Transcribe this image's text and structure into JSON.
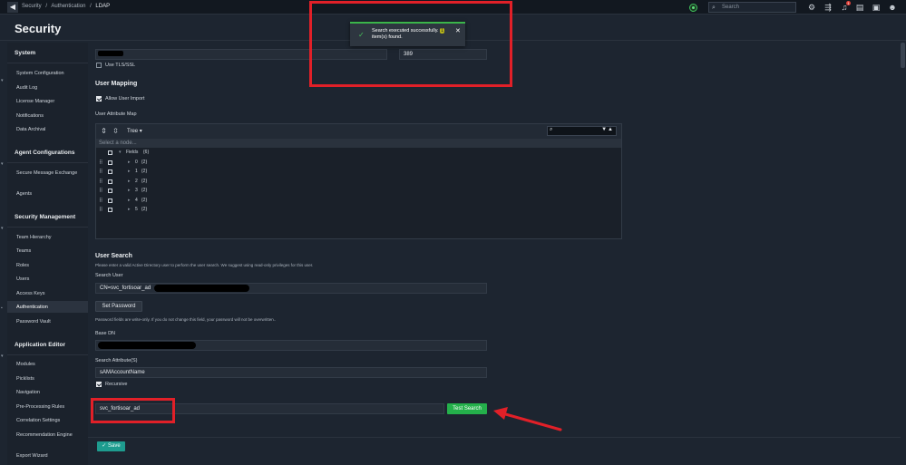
{
  "topbar": {
    "back_icon": "arrow-left-icon",
    "breadcrumb": [
      "Security",
      "/",
      "Authentication",
      "/"
    ],
    "breadcrumb_current": "LDAP",
    "search_placeholder": "Search",
    "notification_count": "1",
    "icons": [
      "status-icon",
      "search-icon",
      "gear-icon",
      "share-icon",
      "bell-icon",
      "clipboard-icon",
      "monitor-icon",
      "user-icon"
    ]
  },
  "page": {
    "title": "Security"
  },
  "sidebar": {
    "sections": [
      {
        "title": "System",
        "items": [
          "System Configuration",
          "Audit Log",
          "License Manager",
          "Notifications",
          "Data Archival"
        ]
      },
      {
        "title": "Agent Configurations",
        "items": [
          "Secure Message Exchange",
          "Agents"
        ]
      },
      {
        "title": "Security Management",
        "items": [
          "Team Hierarchy",
          "Teams",
          "Roles",
          "Users",
          "Access Keys",
          "Authentication",
          "Password Vault"
        ]
      },
      {
        "title": "Application Editor",
        "items": [
          "Modules",
          "Picklists",
          "Navigation",
          "Pre-Processing Rules",
          "Correlation Settings",
          "Recommendation Engine",
          "Export Wizard"
        ]
      }
    ],
    "active_item": "Authentication"
  },
  "form": {
    "port_value": "389",
    "use_tls_label": "Use TLS/SSL",
    "user_mapping_title": "User Mapping",
    "allow_user_import_label": "Allow User Import",
    "user_attribute_map_label": "User Attribute Map",
    "tree": {
      "view_label": "Tree ▾",
      "select_placeholder": "Select a node...",
      "root_label": "Fields",
      "root_count": "{6}",
      "children": [
        {
          "key": "0",
          "count": "{2}"
        },
        {
          "key": "1",
          "count": "{2}"
        },
        {
          "key": "2",
          "count": "{2}"
        },
        {
          "key": "3",
          "count": "{2}"
        },
        {
          "key": "4",
          "count": "{2}"
        },
        {
          "key": "5",
          "count": "{2}"
        }
      ]
    },
    "user_search_title": "User Search",
    "user_search_hint": "Please enter a valid Active Directory user to perform the user search. We suggest using read-only privileges for this user.",
    "search_user_label": "Search User",
    "search_user_value": "CN=svc_fortisoar_ad",
    "set_password_label": "Set Password",
    "password_hint": "Password fields are write-only. If you do not change this field, your password will not be overwritten..",
    "base_dn_label": "Base DN",
    "search_attribute_label": "Search Attribute(S)",
    "search_attribute_value": "sAMAccountName",
    "recursive_label": "Recursive",
    "test_user_value": "svc_fortisoar_ad",
    "test_search_label": "Test Search",
    "save_label": "Save"
  },
  "toast": {
    "message_prefix": "Search executed successfully.",
    "count": "1",
    "message_suffix": "item(s) found."
  },
  "colors": {
    "background": "#1d2530",
    "success": "#24b04b",
    "save": "#1e9c8f",
    "annotation": "#e12028"
  }
}
